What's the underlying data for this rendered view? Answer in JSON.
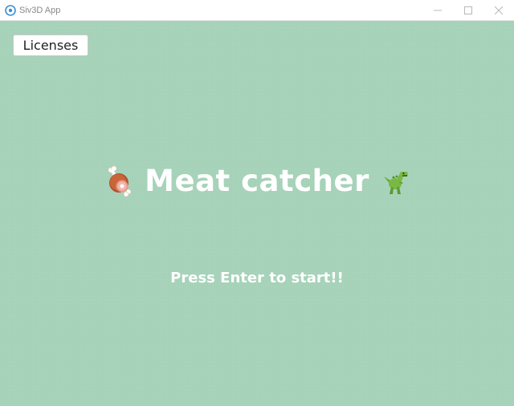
{
  "window": {
    "title": "Siv3D App",
    "icon": "siv3d-app-icon",
    "controls": [
      "minimize-icon",
      "maximize-icon",
      "close-icon"
    ]
  },
  "canvas": {
    "background_color": "#a5d2b8"
  },
  "licenses_button": {
    "label": "Licenses"
  },
  "game": {
    "title": "Meat catcher",
    "left_icon": "meat-on-bone-icon",
    "right_icon": "t-rex-icon",
    "prompt": "Press Enter to start!!"
  }
}
